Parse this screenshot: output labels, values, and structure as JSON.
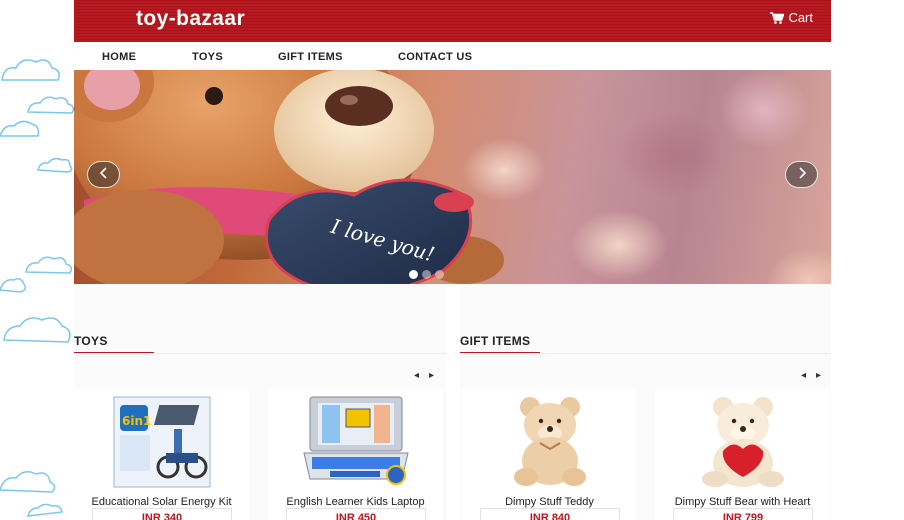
{
  "header": {
    "brand": "toy-bazaar",
    "cart_label": "Cart",
    "brand_color": "#b81921"
  },
  "nav": {
    "items": [
      {
        "label": "HOME"
      },
      {
        "label": "TOYS"
      },
      {
        "label": "GIFT ITEMS"
      },
      {
        "label": "CONTACT US"
      }
    ]
  },
  "slider": {
    "slide_text": "I love you!",
    "dot_count": 3,
    "active_dot": 1
  },
  "sections": [
    {
      "title": "TOYS",
      "products": [
        {
          "name": "Educational Solar Energy Kit",
          "price": "INR 340"
        },
        {
          "name": "English Learner Kids Laptop",
          "price": "INR 450"
        }
      ]
    },
    {
      "title": "GIFT ITEMS",
      "products": [
        {
          "name": "Dimpy Stuff Teddy",
          "price": "INR 840"
        },
        {
          "name": "Dimpy Stuff Bear with Heart",
          "price": "INR 799"
        }
      ]
    }
  ],
  "icons": {
    "cart": "cart-icon",
    "prev": "chevron-left-icon",
    "next": "chevron-right-icon"
  }
}
